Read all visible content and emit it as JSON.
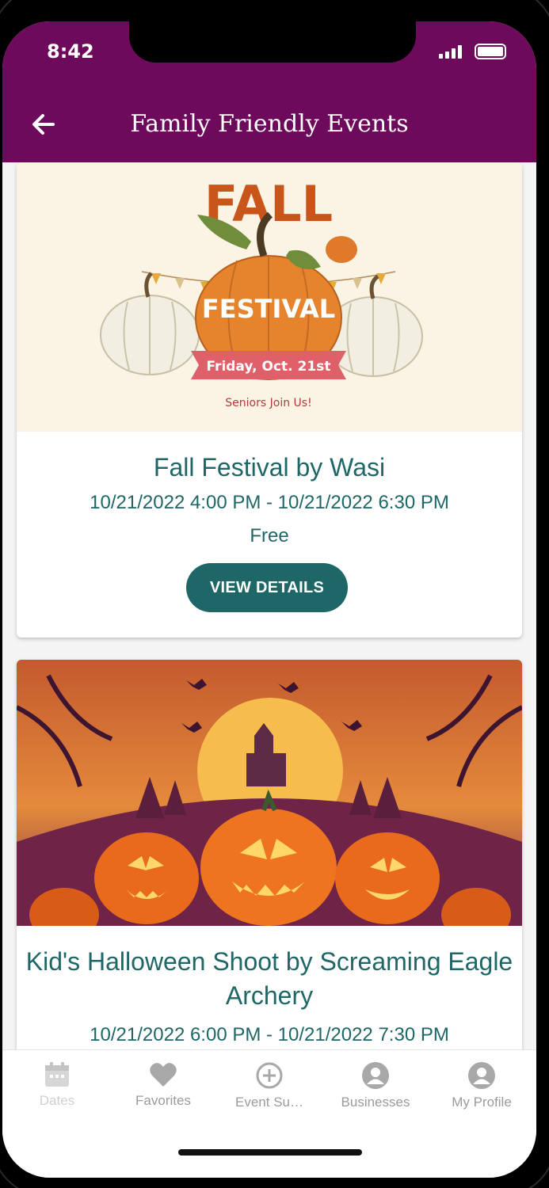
{
  "status_bar": {
    "time": "8:42"
  },
  "header": {
    "title": "Family Friendly Events",
    "back_icon": "arrow-left-icon"
  },
  "colors": {
    "header_bg": "#6d0a5b",
    "accent": "#1f6766"
  },
  "events": [
    {
      "poster": {
        "headline": "FALL",
        "subheadline": "FESTIVAL",
        "date_banner": "Friday, Oct. 21st",
        "tagline": "Seniors Join Us!"
      },
      "title": "Fall Festival by Wasi",
      "datetime": "10/21/2022 4:00 PM - 10/21/2022 6:30 PM",
      "price": "Free",
      "button_label": "VIEW DETAILS"
    },
    {
      "title": "Kid's Halloween Shoot by Screaming Eagle Archery",
      "datetime": "10/21/2022 6:00 PM - 10/21/2022 7:30 PM"
    }
  ],
  "tabbar": {
    "tabs": [
      {
        "label": "Dates",
        "icon": "calendar-icon"
      },
      {
        "label": "Favorites",
        "icon": "heart-icon"
      },
      {
        "label": "Event Su…",
        "icon": "plus-circle-icon"
      },
      {
        "label": "Businesses",
        "icon": "user-circle-icon"
      },
      {
        "label": "My Profile",
        "icon": "user-circle-icon"
      }
    ]
  }
}
